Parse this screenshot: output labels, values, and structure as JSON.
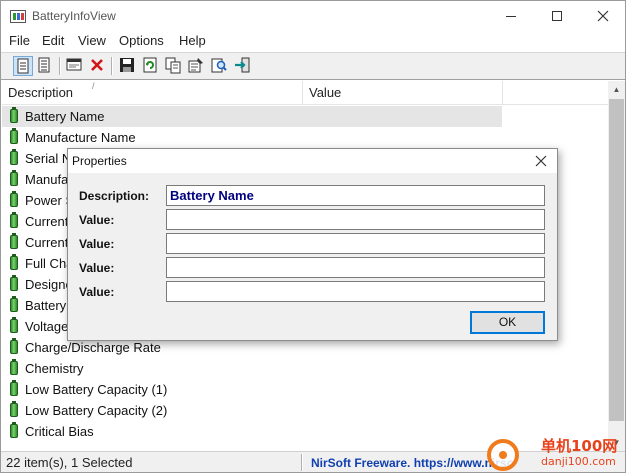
{
  "window": {
    "title": "BatteryInfoView"
  },
  "menu": [
    "File",
    "Edit",
    "View",
    "Options",
    "Help"
  ],
  "toolbar": {
    "icons": [
      "properties-view-icon",
      "list-view-icon",
      "display-window-icon",
      "delete-icon",
      "save-icon",
      "refresh-icon",
      "copy-icon",
      "properties-icon",
      "find-icon",
      "exit-icon"
    ]
  },
  "list": {
    "columns": [
      "Description",
      "Value"
    ],
    "sort_indicator": "/",
    "rows": [
      "Battery Name",
      "Manufacture Name",
      "Serial N",
      "Manufa",
      "Power S",
      "Current",
      "Current",
      "Full Cha",
      "Designe",
      "Battery",
      "Voltage",
      "Charge/Discharge Rate",
      "Chemistry",
      "Low Battery Capacity (1)",
      "Low Battery Capacity (2)",
      "Critical Bias"
    ],
    "selected_index": 0
  },
  "status": {
    "items": "22 item(s), 1 Selected",
    "link": "NirSoft Freeware. https://www.nirso"
  },
  "dialog": {
    "title": "Properties",
    "fields": [
      {
        "label": "Description:",
        "value": "Battery Name"
      },
      {
        "label": "Value:",
        "value": ""
      },
      {
        "label": "Value:",
        "value": ""
      },
      {
        "label": "Value:",
        "value": ""
      },
      {
        "label": "Value:",
        "value": ""
      }
    ],
    "ok_label": "OK"
  },
  "watermark": {
    "name": "单机100网",
    "url": "danji100.com"
  },
  "colors": {
    "accent": "#0078d7",
    "link": "#1040b0",
    "field_text": "#000080",
    "watermark": "#e8421c"
  }
}
